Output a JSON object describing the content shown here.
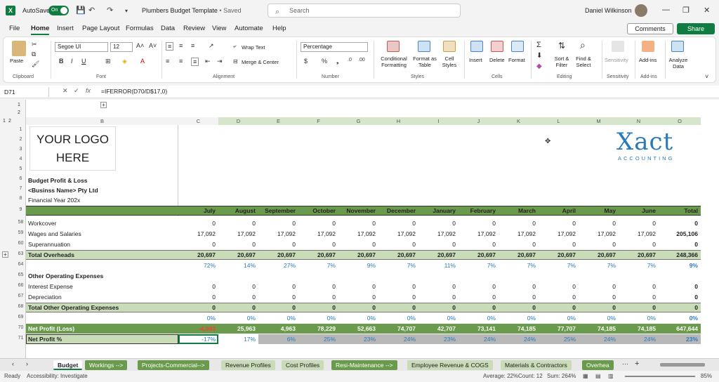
{
  "titlebar": {
    "autosave_label": "AutoSave",
    "autosave_state": "On",
    "doc_title": "Plumbers Budget Template",
    "saved_status": "• Saved",
    "search_placeholder": "Search",
    "user_name": "Daniel Wilkinson"
  },
  "menu": [
    "File",
    "Home",
    "Insert",
    "Page Layout",
    "Formulas",
    "Data",
    "Review",
    "View",
    "Automate",
    "Help"
  ],
  "menu_active": "Home",
  "buttons": {
    "comments": "Comments",
    "share": "Share"
  },
  "ribbon": {
    "paste": "Paste",
    "clipboard": "Clipboard",
    "font_name": "Segoe UI",
    "font_size": "12",
    "font": "Font",
    "wrap_text": "Wrap Text",
    "merge_center": "Merge & Center",
    "alignment": "Alignment",
    "number_format": "Percentage",
    "number": "Number",
    "conditional": "Conditional Formatting",
    "format_table": "Format as Table",
    "cell_styles": "Cell Styles",
    "styles": "Styles",
    "insert": "Insert",
    "delete": "Delete",
    "format": "Format",
    "cells": "Cells",
    "sort_filter": "Sort & Filter",
    "find_select": "Find & Select",
    "editing": "Editing",
    "sensitivity": "Sensitivity",
    "sensitivity_group": "Sensitivity",
    "addins": "Add-ins",
    "addins_group": "Add-ins",
    "analyze": "Analyze Data"
  },
  "formula_bar": {
    "name_box": "D71",
    "formula": "=IFERROR(D70/D$17,0)"
  },
  "columns": [
    "B",
    "C",
    "D",
    "E",
    "F",
    "G",
    "H",
    "I",
    "J",
    "K",
    "L",
    "M",
    "N",
    "O"
  ],
  "logo_text": [
    "YOUR LOGO",
    "HERE"
  ],
  "brand": {
    "name": "Xact",
    "sub": "ACCOUNTING"
  },
  "header_block": {
    "title": "Budget Profit & Loss",
    "business": "<Businss Name> Pty Ltd",
    "year": "Financial Year 202x"
  },
  "months": [
    "July",
    "August",
    "September",
    "October",
    "November",
    "December",
    "January",
    "February",
    "March",
    "April",
    "May",
    "June",
    "Total"
  ],
  "rows": [
    {
      "num": "58",
      "label": "Workcover",
      "values": [
        "0",
        "0",
        "0",
        "0",
        "0",
        "0",
        "0",
        "0",
        "0",
        "0",
        "0",
        "0",
        "0"
      ],
      "style": "plain"
    },
    {
      "num": "59",
      "label": "Wages and Salaries",
      "values": [
        "17,092",
        "17,092",
        "17,092",
        "17,092",
        "17,092",
        "17,092",
        "17,092",
        "17,092",
        "17,092",
        "17,092",
        "17,092",
        "17,092",
        "205,106"
      ],
      "style": "plain"
    },
    {
      "num": "60",
      "label": "Superannuation",
      "values": [
        "0",
        "0",
        "0",
        "0",
        "0",
        "0",
        "0",
        "0",
        "0",
        "0",
        "0",
        "0",
        "0"
      ],
      "style": "plain"
    },
    {
      "num": "63",
      "label": "Total Overheads",
      "values": [
        "20,697",
        "20,697",
        "20,697",
        "20,697",
        "20,697",
        "20,697",
        "20,697",
        "20,697",
        "20,697",
        "20,697",
        "20,697",
        "20,697",
        "248,366"
      ],
      "style": "subtotal"
    },
    {
      "num": "64",
      "label": "",
      "values": [
        "72%",
        "14%",
        "27%",
        "7%",
        "9%",
        "7%",
        "11%",
        "7%",
        "7%",
        "7%",
        "7%",
        "7%",
        "9%"
      ],
      "style": "pct"
    },
    {
      "num": "65",
      "label": "Other Operating Expenses",
      "values": [
        "",
        "",
        "",
        "",
        "",
        "",
        "",
        "",
        "",
        "",
        "",
        "",
        ""
      ],
      "style": "heading"
    },
    {
      "num": "66",
      "label": "Interest Expense",
      "values": [
        "0",
        "0",
        "0",
        "0",
        "0",
        "0",
        "0",
        "0",
        "0",
        "0",
        "0",
        "0",
        "0"
      ],
      "style": "plain"
    },
    {
      "num": "67",
      "label": "Depreciation",
      "values": [
        "0",
        "0",
        "0",
        "0",
        "0",
        "0",
        "0",
        "0",
        "0",
        "0",
        "0",
        "0",
        "0"
      ],
      "style": "plain"
    },
    {
      "num": "68",
      "label": "Total Other Operating Expenses",
      "values": [
        "0",
        "0",
        "0",
        "0",
        "0",
        "0",
        "0",
        "0",
        "0",
        "0",
        "0",
        "0",
        "0"
      ],
      "style": "subtotal"
    },
    {
      "num": "69",
      "label": "",
      "values": [
        "0%",
        "0%",
        "0%",
        "0%",
        "0%",
        "0%",
        "0%",
        "0%",
        "0%",
        "0%",
        "0%",
        "0%",
        "0%"
      ],
      "style": "pct"
    },
    {
      "num": "70",
      "label": "Net Profit (Loss)",
      "values": [
        "-4,993",
        "25,963",
        "4,963",
        "78,229",
        "52,663",
        "74,707",
        "42,707",
        "73,141",
        "74,185",
        "77,707",
        "74,185",
        "74,185",
        "647,644"
      ],
      "style": "net"
    },
    {
      "num": "71",
      "label": "Net Profit %",
      "values": [
        "-17%",
        "17%",
        "6%",
        "25%",
        "23%",
        "24%",
        "23%",
        "24%",
        "24%",
        "25%",
        "24%",
        "24%",
        "23%"
      ],
      "style": "netpct"
    }
  ],
  "sheet_tabs": [
    {
      "label": "Budget",
      "kind": "active"
    },
    {
      "label": "Workings -->",
      "kind": "dark"
    },
    {
      "label": "Projects-Commercial-->",
      "kind": "dark"
    },
    {
      "label": "Revenue Profiles",
      "kind": "light"
    },
    {
      "label": "Cost Profiles",
      "kind": "light"
    },
    {
      "label": "Resi-Maintenance -->",
      "kind": "dark"
    },
    {
      "label": "Employee Revenue & COGS",
      "kind": "light"
    },
    {
      "label": "Materials & Contractors",
      "kind": "light"
    },
    {
      "label": "Overhea",
      "kind": "dark"
    }
  ],
  "status": {
    "ready": "Ready",
    "accessibility": "Accessibility: Investigate",
    "average": "Average: 22%",
    "count": "Count: 12",
    "sum": "Sum: 264%",
    "zoom": "85%"
  }
}
